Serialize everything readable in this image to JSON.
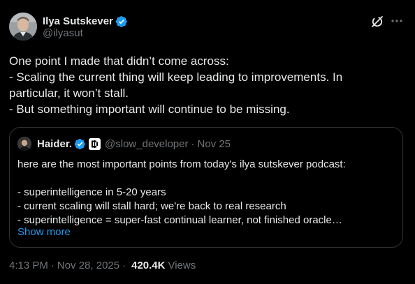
{
  "colors": {
    "background": "#000000",
    "text_primary": "#e7e9ea",
    "text_secondary": "#71767b",
    "link_blue": "#1d9bf0",
    "verified_blue": "#1d9bf0",
    "border": "#2f3336"
  },
  "author": {
    "name": "Ilya Sutskever",
    "handle": "@ilyasut",
    "verified": true,
    "avatar_icon": "avatar-photo"
  },
  "header_actions": {
    "grok_icon": "grok-icon",
    "more_icon": "more-horizontal-icon"
  },
  "tweet": {
    "lines": [
      "One point I made that didn’t come across:",
      "- Scaling the current thing will keep leading to improvements.  In",
      "particular, it won’t stall.",
      "- But something important will continue to be missing."
    ]
  },
  "quote": {
    "name": "Haider.",
    "handle": "@slow_developer",
    "separator": "·",
    "date": "Nov 25",
    "verified": true,
    "badge_icon": "perplexity-badge-icon",
    "lines": [
      "here are the most important points from today's ilya sutskever podcast:",
      "",
      "- superintelligence in 5-20 years",
      "- current scaling will stall hard; we're back to real research",
      "- superintelligence = super-fast continual learner, not finished oracle…"
    ],
    "show_more": "Show more"
  },
  "meta": {
    "time": "4:13 PM",
    "separator": "·",
    "date": "Nov 28, 2025",
    "views_count": "420.4K",
    "views_label": "Views"
  }
}
